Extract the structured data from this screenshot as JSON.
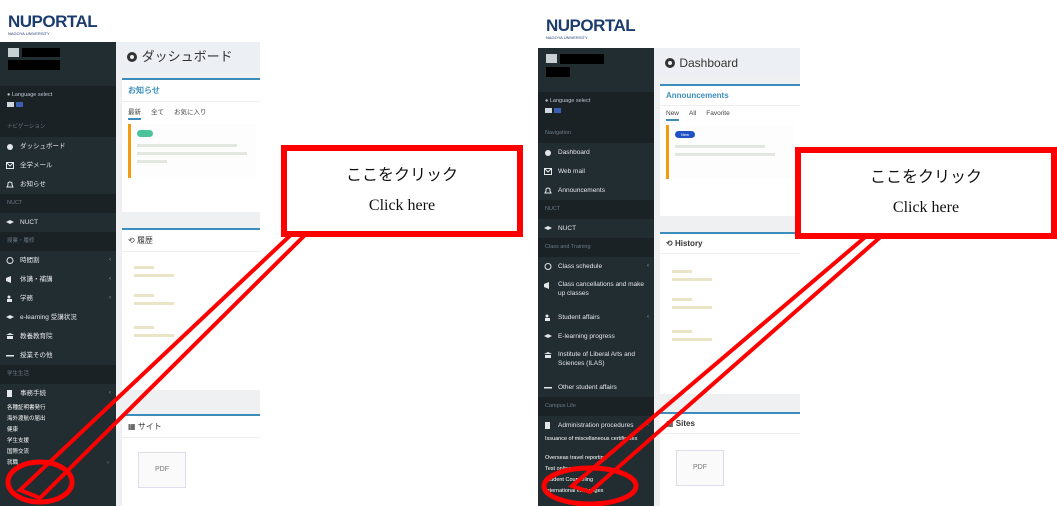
{
  "left": {
    "brand": "NUPORTAL",
    "title": "ダッシュボード",
    "language_label": "Language select",
    "nav_header": "ナビゲーション",
    "top_items": [
      "ダッシュボード",
      "全学メール",
      "お知らせ"
    ],
    "nuct_header": "NUCT",
    "nuct_item": "NUCT",
    "study_header": "授業・履修",
    "study_items": [
      "時間割",
      "休講・補講",
      "学務",
      "e-learning 受講状況",
      "教養教育院",
      "授業その他"
    ],
    "campus_header": "学生生活",
    "campus_items": [
      "事務手続",
      "各種証明書発行",
      "海外渡航の届出",
      "健康",
      "学生支援",
      "国際交流",
      "就職"
    ],
    "announcements_title": "お知らせ",
    "tabs": [
      "最新",
      "全て",
      "お気に入り"
    ],
    "history_title": "履歴",
    "sites_title": "サイト",
    "pdf_label": "PDF"
  },
  "right": {
    "brand": "NUPORTAL",
    "title": "Dashboard",
    "language_label": "Language select",
    "nav_header": "Navigation",
    "top_items": [
      "Dashboard",
      "Web mail",
      "Announcements"
    ],
    "nuct_header": "NUCT",
    "nuct_item": "NUCT",
    "study_header": "Class and Training",
    "study_items": [
      "Class schedule",
      "Class cancellations and make up classes",
      "Student affairs",
      "E-learning progress",
      "Institute of Liberal Arts and Sciences (ILAS)",
      "Other student affairs"
    ],
    "campus_header": "Campus Life",
    "campus_items": [
      "Administration procedures",
      "Issuance of miscellaneous certificates",
      "Overseas travel reporting",
      "Test online",
      "Student Counseling",
      "International exchanges"
    ],
    "announcements_title": "Announcements",
    "tabs": [
      "New",
      "All",
      "Favorite"
    ],
    "new_badge": "New",
    "history_title": "History",
    "sites_title": "Sites",
    "pdf_label": "PDF"
  },
  "callout": {
    "jp": "ここをクリック",
    "en": "Click here"
  },
  "colors": {
    "sidebar": "#222d32",
    "accent": "#3c8dbc",
    "highlight": "#ff0000"
  }
}
